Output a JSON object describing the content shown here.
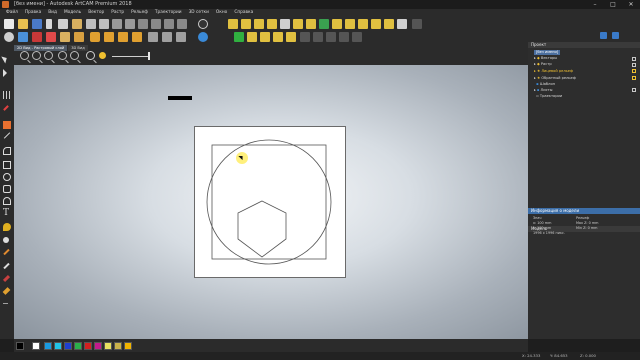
{
  "window": {
    "title": "[без имени] - Autodesk ArtCAM Premium 2018",
    "controls": [
      "minimize-icon",
      "maximize-icon",
      "close-icon"
    ]
  },
  "menu": {
    "items": [
      "Файл",
      "Правка",
      "Вид",
      "Модель",
      "Вектор",
      "Растр",
      "Рельеф",
      "Траектории",
      "3D сетки",
      "Окно",
      "Справка"
    ]
  },
  "tabs": {
    "items": [
      "2D Вид - Растровый слой",
      "3D Вид"
    ]
  },
  "project_panel": {
    "header": "Проект",
    "root": "[без имени]",
    "items": [
      {
        "label": "Векторы",
        "style": "normal"
      },
      {
        "label": "Растр",
        "style": "normal"
      },
      {
        "label": "Лицевой рельеф",
        "style": "highlight"
      },
      {
        "label": "Обратный рельеф",
        "style": "normal"
      },
      {
        "label": "Шаблон",
        "style": "normal"
      },
      {
        "label": "Листы",
        "style": "normal"
      },
      {
        "label": "Траектории",
        "style": "normal"
      }
    ]
  },
  "model_panel": {
    "header": "Модель"
  },
  "model_info": {
    "header": "Информация о модели",
    "size_label": "Знач",
    "x_value": "x: 100 mm",
    "y_value": "y: 100 mm",
    "pixels_value": "1996 x 1996 пикс.",
    "relief_label": "Рельеф",
    "relief_max": "Max Z: 0 mm",
    "relief_min": "Min Z: 0 mm"
  },
  "palette": {
    "colors": [
      "#000000",
      "#ffffff",
      "#1a9ae0",
      "#22c4e8",
      "#1f3fd1",
      "#2bb04a",
      "#d22020",
      "#c21a8c",
      "#e8e060",
      "#c9b14a",
      "#f0b400"
    ]
  },
  "status": {
    "x": "X: 24.333",
    "y": "Y: 84.653",
    "z": "Z: 0.000"
  }
}
